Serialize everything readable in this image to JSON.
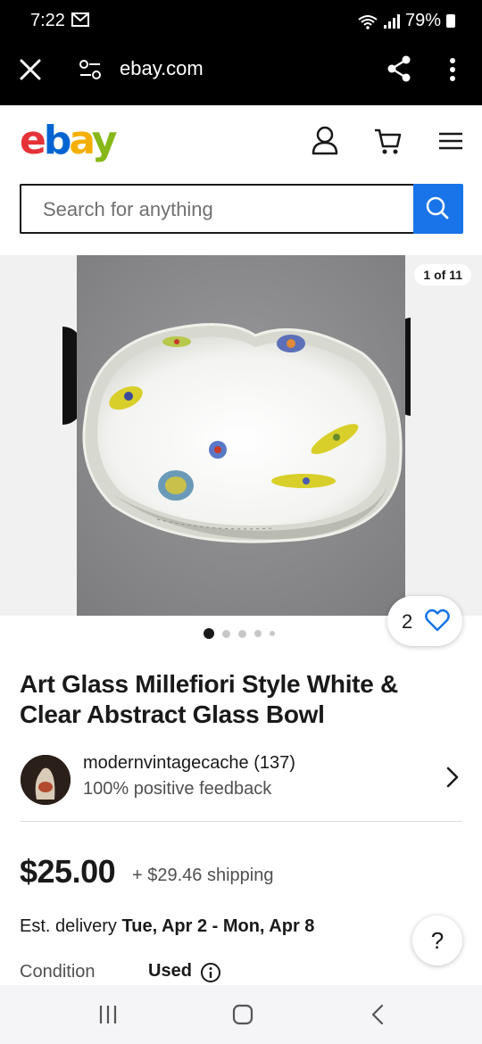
{
  "status_bar": {
    "time": "7:22",
    "battery": "79%"
  },
  "browser": {
    "url": "ebay.com"
  },
  "header": {
    "logo": [
      "e",
      "b",
      "a",
      "y"
    ],
    "brand_colors": {
      "e": "#e53238",
      "b": "#0064d2",
      "a": "#f5af02",
      "y": "#86b817"
    },
    "icons": [
      "account-icon",
      "cart-icon",
      "menu-icon"
    ]
  },
  "search": {
    "placeholder": "Search for anything",
    "button_color": "#1874e8"
  },
  "gallery": {
    "counter": "1 of 11",
    "dots_count": 5,
    "active_dot": 0
  },
  "watch": {
    "count": "2"
  },
  "listing": {
    "title": "Art Glass Millefiori Style White & Clear Abstract Glass Bowl",
    "seller": {
      "name": "modernvintagecache (137)",
      "feedback": "100% positive feedback"
    },
    "price": "$25.00",
    "shipping": "+ $29.46 shipping",
    "delivery_label": "Est. delivery",
    "delivery_dates": "Tue, Apr 2 - Mon, Apr 8",
    "condition_label": "Condition",
    "condition_value": "Used"
  },
  "help": {
    "label": "?"
  }
}
